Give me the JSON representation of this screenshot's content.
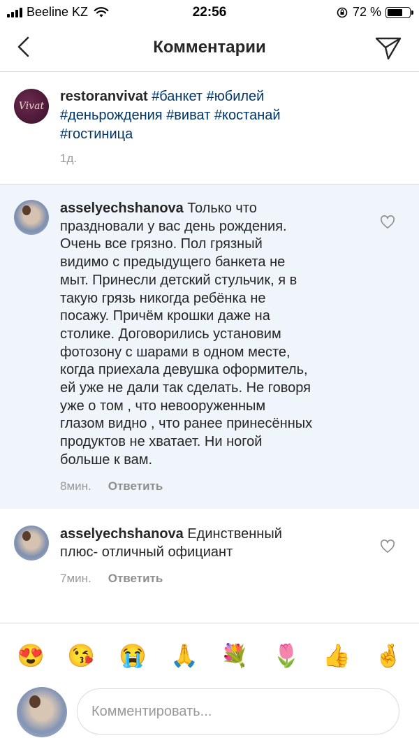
{
  "status_bar": {
    "carrier": "Beeline KZ",
    "time": "22:56",
    "battery_percent": "72 %",
    "battery_level": 0.72
  },
  "header": {
    "title": "Комментарии",
    "back_icon": "chevron-left-icon",
    "send_icon": "paper-plane-icon"
  },
  "caption": {
    "avatar_text": "Vivat",
    "username": "restoranvivat",
    "hashtags": [
      "#банкет",
      "#юбилей",
      "#деньрождения",
      "#виват",
      "#костанай",
      "#гостиница"
    ],
    "time": "1д."
  },
  "comments": [
    {
      "username": "asselyechshanova",
      "lines": [
        "Только что",
        "праздновали у вас день рождения.",
        "Очень все грязно. Пол грязный",
        "видимо с предыдущего банкета не",
        "мыт. Принесли детский стульчик, я в",
        "такую грязь никогда ребёнка не",
        "посажу. Причём крошки даже на",
        "столике. Договорились установим",
        "фотозону с шарами в одном месте,",
        "когда приехала девушка оформитель,",
        "ей уже не дали так сделать. Не говоря",
        "уже о том , что невооруженным",
        "глазом видно , что ранее принесённых",
        "продуктов не хватает. Ни ногой",
        "больше к вам."
      ],
      "time": "8мин.",
      "reply_label": "Ответить",
      "highlighted": true
    },
    {
      "username": "asselyechshanova",
      "lines": [
        "Единственный",
        "плюс- отличный официант"
      ],
      "time": "7мин.",
      "reply_label": "Ответить",
      "highlighted": false
    }
  ],
  "emoji_bar": [
    "😍",
    "😘",
    "😭",
    "🙏",
    "💐",
    "🌷",
    "👍",
    "🤞"
  ],
  "composer": {
    "placeholder": "Комментировать..."
  },
  "colors": {
    "hashtag": "#003569",
    "highlight_bg": "#eff5fb",
    "meta_text": "#999999"
  }
}
